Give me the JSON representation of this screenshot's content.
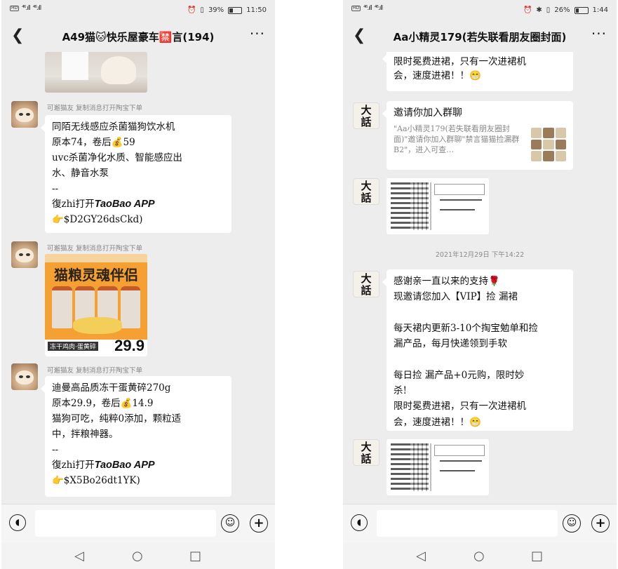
{
  "left": {
    "status": {
      "hd1": "HD",
      "hd2": "HD",
      "net1": "⁴⁶.ıll",
      "net2": "⁴⁶.ıll",
      "battery_pct": "39%",
      "time": "11:50"
    },
    "title": "A49猫🐱快乐屋豪车🈲言(194)",
    "messages": [
      {
        "sender": "可邂猫友 复制消息打开陶宝下单",
        "lines": [
          "同陌无线感应杀菌猫狗饮水机",
          "原本74，卷后💰59",
          "uvc杀菌净化水质、智能感应出",
          "水、静音水泵",
          "--",
          "復zhi打开",
          "👉$D2GY26dsCkd)"
        ],
        "app": "TaoBao APP"
      },
      {
        "sender": "可邂猫友 复制消息打开陶宝下单",
        "poster": {
          "band": "冻干鸡肉·蛋黄碎",
          "title": "猫粮灵魂伴侣",
          "tag": "冻干鸡肉·蛋黄碎",
          "price": "29.9"
        }
      },
      {
        "sender": "可邂猫友 复制消息打开陶宝下单",
        "lines": [
          "迪曼高品质冻干蛋黄碎270g",
          "原本29.9，卷后💰14.9",
          "猫狗可吃，纯粹0添加，颗粒适",
          "中，拌粮神器。",
          "--",
          "復zhi打开",
          "👉$X5Bo26dt1YK)"
        ],
        "app": "TaoBao APP"
      }
    ]
  },
  "right": {
    "status": {
      "hd1": "HD",
      "hd2": "HD",
      "net1": "⁴⁶.ıll",
      "net2": "⁴⁶.ıll",
      "battery_pct": "26%",
      "time": "1:44"
    },
    "title": "Aa小精灵179(若失联看朋友圈封面)",
    "top_bubble": [
      "✓",
      "限时冕费进裙，只有一次进裙机",
      "会，速度进裙！！😁"
    ],
    "card": {
      "title": "邀请你加入群聊",
      "desc": "\"Aa小精灵179(若失联看朋友圈封面)\"邀请你加入群聊\"禁言猫猫捡漏群B2\"，进入可查…"
    },
    "timestamp": "2021年12月29日 下午14:22",
    "text_bubble": [
      "感谢亲一直以来的支持🌹",
      "现邀请您加入【VIP】捡 漏裙",
      "",
      "每天裙内更新3-10个掏宝勉单和捡",
      "漏产品，每月快递领到手软",
      "",
      "每日捡 漏产品+0元购，限时妙",
      "杀!",
      "限时冕费进裙，只有一次进裙机",
      "会，速度进裙！！😁"
    ],
    "avatar_text": [
      "大",
      "話"
    ]
  }
}
